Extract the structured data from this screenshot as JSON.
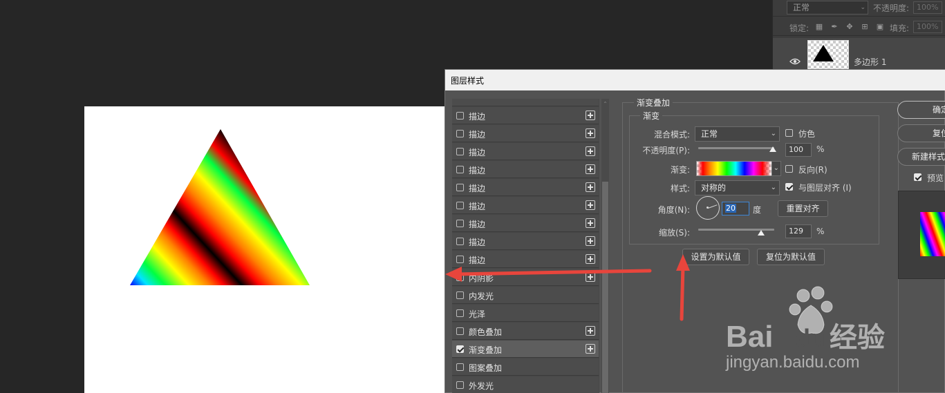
{
  "layers_panel": {
    "blend_mode": "正常",
    "opacity_label": "不透明度:",
    "opacity_value": "100%",
    "lock_label": "锁定:",
    "fill_label": "填充:",
    "fill_value": "100%",
    "layer_name": "多边形 1"
  },
  "dialog": {
    "title": "图层样式",
    "style_list": [
      {
        "label": "描边",
        "checked": false,
        "has_plus": true
      },
      {
        "label": "描边",
        "checked": false,
        "has_plus": true
      },
      {
        "label": "描边",
        "checked": false,
        "has_plus": true
      },
      {
        "label": "描边",
        "checked": false,
        "has_plus": true
      },
      {
        "label": "描边",
        "checked": false,
        "has_plus": true
      },
      {
        "label": "描边",
        "checked": false,
        "has_plus": true
      },
      {
        "label": "描边",
        "checked": false,
        "has_plus": true
      },
      {
        "label": "描边",
        "checked": false,
        "has_plus": true
      },
      {
        "label": "描边",
        "checked": false,
        "has_plus": true
      },
      {
        "label": "内阴影",
        "checked": false,
        "has_plus": true
      },
      {
        "label": "内发光",
        "checked": false,
        "has_plus": false
      },
      {
        "label": "光泽",
        "checked": false,
        "has_plus": false
      },
      {
        "label": "颜色叠加",
        "checked": false,
        "has_plus": true
      },
      {
        "label": "渐变叠加",
        "checked": true,
        "has_plus": true,
        "active": true
      },
      {
        "label": "图案叠加",
        "checked": false,
        "has_plus": false
      },
      {
        "label": "外发光",
        "checked": false,
        "has_plus": false
      }
    ],
    "gradient_overlay": {
      "section_title": "渐变叠加",
      "group_title": "渐变",
      "blend_mode_label": "混合模式:",
      "blend_mode_value": "正常",
      "dither_label": "仿色",
      "dither_checked": false,
      "opacity_label": "不透明度(P):",
      "opacity_value": "100",
      "opacity_fraction": 1.0,
      "percent": "%",
      "gradient_label": "渐变:",
      "reverse_label": "反向(R)",
      "reverse_checked": false,
      "style_label": "样式:",
      "style_value": "对称的",
      "align_label": "与图层对齐 (I)",
      "align_checked": true,
      "angle_label": "角度(N):",
      "angle_value": "20",
      "degree_label": "度",
      "reset_align_button": "重置对齐",
      "scale_label": "缩放(S):",
      "scale_value": "129",
      "make_default_button": "设置为默认值",
      "reset_default_button": "复位为默认值"
    },
    "right_buttons": {
      "ok": "确定",
      "reset": "复位",
      "new_style": "新建样式...",
      "preview_label": "预览",
      "preview_checked": true
    }
  },
  "colors": {
    "annotation_arrow": "#e8453c",
    "dialog_bg": "#535353",
    "workspace_bg": "#262626"
  }
}
